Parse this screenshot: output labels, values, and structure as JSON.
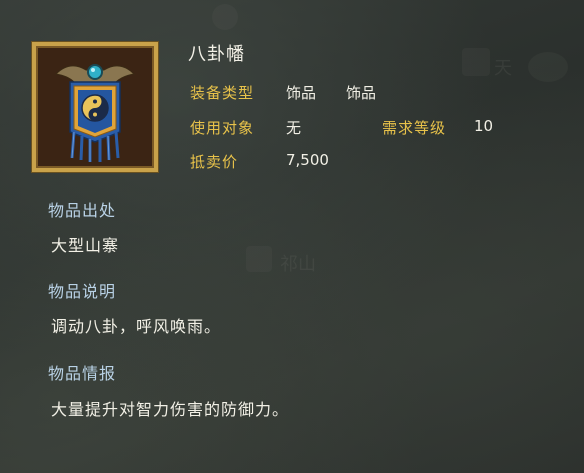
{
  "item": {
    "name": "八卦幡",
    "icon": "banner-icon"
  },
  "stats": {
    "equip_type_label": "装备类型",
    "equip_type_value_1": "饰品",
    "equip_type_value_2": "饰品",
    "target_label": "使用对象",
    "target_value": "无",
    "level_req_label": "需求等级",
    "level_req_value": "10",
    "sell_label": "抵卖价",
    "sell_value": "7,500"
  },
  "sections": {
    "source_title": "物品出处",
    "source_text": "大型山寨",
    "desc_title": "物品说明",
    "desc_text": "调动八卦，呼风唤雨。",
    "info_title": "物品情报",
    "info_text": "大量提升对智力伤害的防御力。"
  },
  "background_watermarks": {
    "mark_1": "天",
    "mark_2": "祁山"
  },
  "colors": {
    "label_gold": "#e8c24a",
    "section_blue": "#b9d2e6",
    "text_white": "#f2f0e6",
    "frame_gold": "#c9a24a"
  }
}
